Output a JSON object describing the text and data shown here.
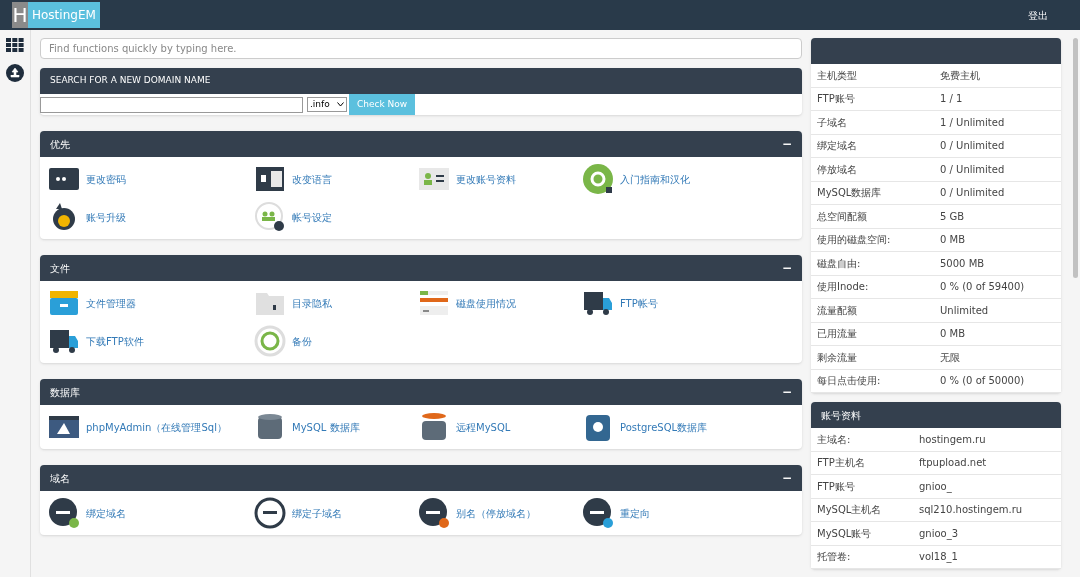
{
  "header": {
    "logo_letter": "H",
    "logo_text": "HostingEM",
    "logout": "登出"
  },
  "search": {
    "placeholder": "Find functions quickly by typing here."
  },
  "domain_search": {
    "title": "SEARCH FOR A NEW DOMAIN NAME",
    "tld": ".info",
    "button": "Check Now"
  },
  "sections": [
    {
      "title": "优先",
      "collapse": "−",
      "items": [
        "更改密码",
        "改变语言",
        "更改账号资料",
        "入门指南和汉化",
        "账号升级",
        "帐号设定"
      ]
    },
    {
      "title": "文件",
      "collapse": "−",
      "items": [
        "文件管理器",
        "目录隐私",
        "磁盘使用情况",
        "FTP帐号",
        "下载FTP软件",
        "备份"
      ]
    },
    {
      "title": "数据库",
      "collapse": "−",
      "items": [
        "phpMyAdmin（在线管理Sql）",
        "MySQL 数据库",
        "远程MySQL",
        "PostgreSQL数据库"
      ]
    },
    {
      "title": "域名",
      "collapse": "−",
      "items": [
        "绑定域名",
        "绑定子域名",
        "别名（停放域名）",
        "重定向"
      ]
    }
  ],
  "stats": {
    "rows": [
      {
        "label": "主机类型",
        "value": "免费主机"
      },
      {
        "label": "FTP账号",
        "value": "1 / 1"
      },
      {
        "label": "子域名",
        "value": "1 / Unlimited"
      },
      {
        "label": "绑定域名",
        "value": "0 / Unlimited"
      },
      {
        "label": "停放域名",
        "value": "0 / Unlimited"
      },
      {
        "label": "MySQL数据库",
        "value": "0 / Unlimited"
      },
      {
        "label": "总空间配额",
        "value": "5 GB"
      },
      {
        "label": "使用的磁盘空间:",
        "value": "0 MB"
      },
      {
        "label": "磁盘自由:",
        "value": "5000 MB"
      },
      {
        "label": "使用Inode:",
        "value": "0 % (0 of 59400)"
      },
      {
        "label": "流量配额",
        "value": "Unlimited"
      },
      {
        "label": "已用流量",
        "value": "0 MB"
      },
      {
        "label": "剩余流量",
        "value": "无限"
      },
      {
        "label": "每日点击使用:",
        "value": "0 % (0 of 50000)"
      }
    ]
  },
  "account": {
    "title": "账号资料",
    "rows": [
      {
        "label": "主域名:",
        "value": "hostingem.ru"
      },
      {
        "label": "FTP主机名",
        "value": "ftpupload.net"
      },
      {
        "label": "FTP账号",
        "value": "gnioo_"
      },
      {
        "label": "MySQL主机名",
        "value": "sql210.hostingem.ru"
      },
      {
        "label": "MySQL账号",
        "value": "gnioo_3"
      },
      {
        "label": "托管卷:",
        "value": "vol18_1"
      }
    ]
  }
}
